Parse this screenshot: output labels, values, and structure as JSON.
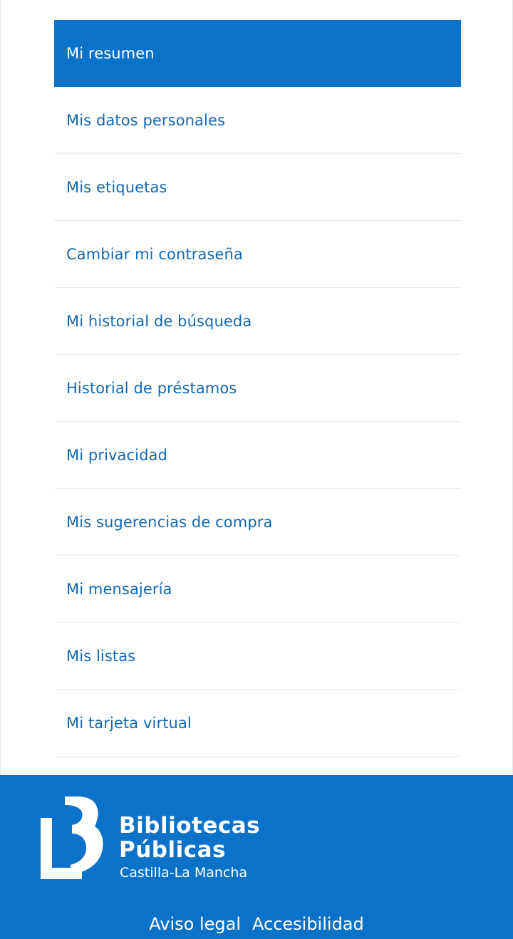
{
  "menu": {
    "items": [
      {
        "label": "Mi resumen",
        "active": true
      },
      {
        "label": "Mis datos personales",
        "active": false
      },
      {
        "label": "Mis etiquetas",
        "active": false
      },
      {
        "label": "Cambiar mi contraseña",
        "active": false
      },
      {
        "label": "Mi historial de búsqueda",
        "active": false
      },
      {
        "label": "Historial de préstamos",
        "active": false
      },
      {
        "label": "Mi privacidad",
        "active": false
      },
      {
        "label": "Mis sugerencias de compra",
        "active": false
      },
      {
        "label": "Mi mensajería",
        "active": false
      },
      {
        "label": "Mis listas",
        "active": false
      },
      {
        "label": "Mi tarjeta virtual",
        "active": false
      }
    ]
  },
  "footer": {
    "logo": {
      "line1": "Bibliotecas",
      "line2": "Públicas",
      "line3": "Castilla-La Mancha",
      "icon": "bibliotecas-lb-logo-icon"
    },
    "links": {
      "legal": "Aviso legal",
      "accessibility": "Accesibilidad"
    }
  },
  "colors": {
    "accent": "#0a73c9",
    "link_text": "#1268b3",
    "divider": "#ececec"
  }
}
